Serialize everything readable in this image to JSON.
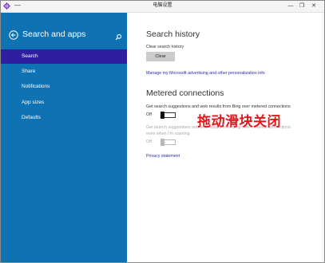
{
  "window": {
    "title": "电脑设置",
    "sys_menu_glyph": "—",
    "min_glyph": "—",
    "max_glyph": "❐",
    "close_glyph": "✕",
    "app_icon": "gear-icon",
    "accent_color": "#7b3fbf"
  },
  "sidebar": {
    "heading": "Search and apps",
    "back_icon": "back-arrow-icon",
    "search_icon": "search-icon",
    "background": "#0f73b3",
    "selected_color": "#2f1fa0",
    "items": [
      {
        "label": "Search",
        "selected": true
      },
      {
        "label": "Share",
        "selected": false
      },
      {
        "label": "Notifications",
        "selected": false
      },
      {
        "label": "App sizes",
        "selected": false
      },
      {
        "label": "Defaults",
        "selected": false
      }
    ]
  },
  "search_history": {
    "title": "Search history",
    "clear_label": "Clear search history",
    "clear_button": "Clear",
    "manage_link": "Manage my Microsoft advertising and other personalization info"
  },
  "metered": {
    "title": "Metered connections",
    "option1_text": "Get search suggestions and web results from Bing over metered connections",
    "option1_state": "Off",
    "option2_text_line1": "Get search suggestions and web results from Bing over metered connections",
    "option2_text_line2": "even when I'm roaming",
    "option2_state": "Off",
    "privacy_link": "Privacy statement"
  },
  "annotation": {
    "text": "拖动滑块关闭",
    "color": "#e0171d"
  }
}
